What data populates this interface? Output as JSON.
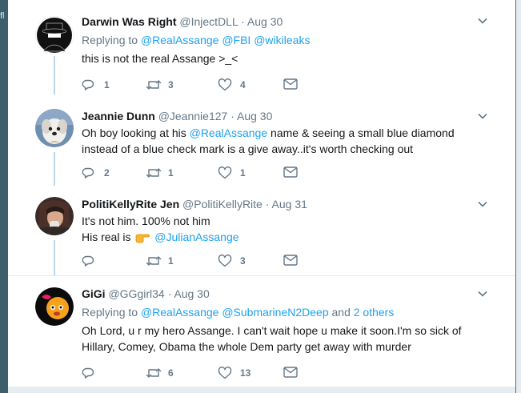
{
  "background": {
    "edge_text": "fl"
  },
  "tweets": [
    {
      "name": "Darwin Was Right",
      "handle": "@InjectDLL",
      "dot": "·",
      "time": "Aug 30",
      "reply_prefix": "Replying to",
      "reply_to": [
        "@RealAssange",
        "@FBI",
        "@wikileaks"
      ],
      "text": "this is not the real Assange >_<",
      "replies": "1",
      "retweets": "3",
      "likes": "4"
    },
    {
      "name": "Jeannie Dunn",
      "handle": "@Jeannie127",
      "dot": "·",
      "time": "Aug 30",
      "text_before": "Oh boy  looking at his ",
      "text_mention": "@RealAssange",
      "text_after": " name & seeing a small blue diamond instead of a blue check mark is a give away..it's worth checking out",
      "replies": "2",
      "retweets": "1",
      "likes": "1"
    },
    {
      "name": "PolitiKellyRite Jen",
      "handle": "@PolitiKellyRite",
      "dot": "·",
      "time": "Aug 31",
      "line1": "It's not him. 100% not him",
      "line2_prefix": "His real is",
      "line2_mention": "@JulianAssange",
      "replies": "",
      "retweets": "1",
      "likes": "3"
    },
    {
      "name": "GiGi",
      "handle": "@GGgirl34",
      "dot": "·",
      "time": "Aug 30",
      "reply_prefix": "Replying to",
      "reply_to": [
        "@RealAssange",
        "@SubmarineN2Deep"
      ],
      "reply_suffix_and": "and",
      "reply_others": "2 others",
      "text": "Oh Lord, u r my hero Assange. I can't wait hope u make it soon.I'm so sick of Hillary, Comey, Obama the whole Dem party get away with murder",
      "replies": "",
      "retweets": "6",
      "likes": "13"
    }
  ],
  "colors": {
    "link": "#1da1f2",
    "muted": "#657786",
    "thread": "#b8d7ec"
  },
  "icons": [
    "reply-icon",
    "retweet-icon",
    "like-icon",
    "message-icon",
    "chevron-down-icon"
  ]
}
